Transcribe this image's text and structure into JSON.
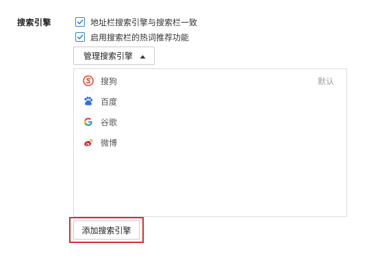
{
  "section": {
    "title": "搜索引擎"
  },
  "options": [
    {
      "label": "地址栏搜索引擎与搜索栏一致",
      "checked": true
    },
    {
      "label": "启用搜索栏的热词推荐功能",
      "checked": true
    }
  ],
  "manage_button": {
    "label": "管理搜索引擎",
    "icon": "caret-up-icon"
  },
  "engines": [
    {
      "name": "搜狗",
      "icon": "sogou-icon",
      "badge": "默认"
    },
    {
      "name": "百度",
      "icon": "baidu-icon",
      "badge": ""
    },
    {
      "name": "谷歌",
      "icon": "google-icon",
      "badge": ""
    },
    {
      "name": "微博",
      "icon": "weibo-icon",
      "badge": ""
    }
  ],
  "add_button": {
    "label": "添加搜索引擎"
  },
  "colors": {
    "checkbox_accent": "#2f7fe4",
    "highlight_border": "#d8292f",
    "sogou": "#e8462c",
    "baidu": "#2f6fe4",
    "weibo": "#e6162d"
  }
}
